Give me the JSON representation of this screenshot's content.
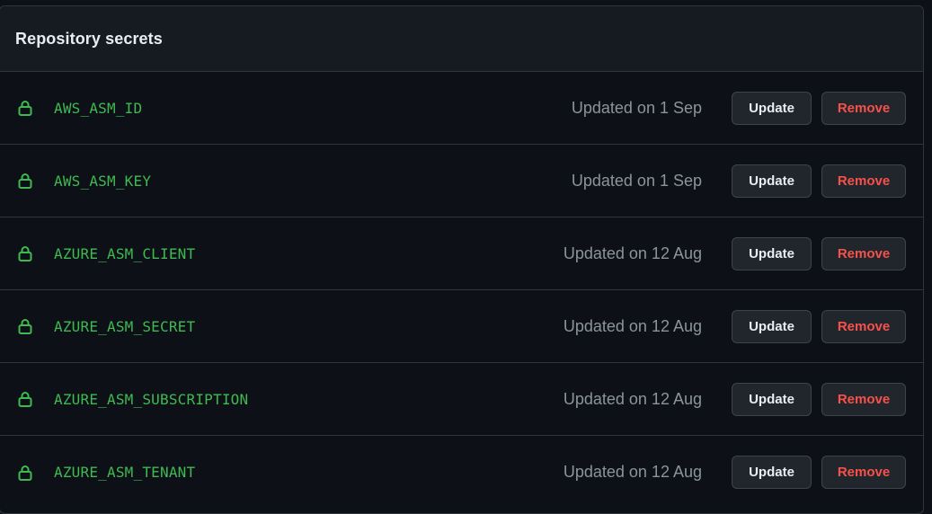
{
  "panel": {
    "title": "Repository secrets"
  },
  "secrets": [
    {
      "name": "AWS_ASM_ID",
      "updated": "Updated on 1 Sep",
      "update_label": "Update",
      "remove_label": "Remove"
    },
    {
      "name": "AWS_ASM_KEY",
      "updated": "Updated on 1 Sep",
      "update_label": "Update",
      "remove_label": "Remove"
    },
    {
      "name": "AZURE_ASM_CLIENT",
      "updated": "Updated on 12 Aug",
      "update_label": "Update",
      "remove_label": "Remove"
    },
    {
      "name": "AZURE_ASM_SECRET",
      "updated": "Updated on 12 Aug",
      "update_label": "Update",
      "remove_label": "Remove"
    },
    {
      "name": "AZURE_ASM_SUBSCRIPTION",
      "updated": "Updated on 12 Aug",
      "update_label": "Update",
      "remove_label": "Remove"
    },
    {
      "name": "AZURE_ASM_TENANT",
      "updated": "Updated on 12 Aug",
      "update_label": "Update",
      "remove_label": "Remove"
    }
  ],
  "icons": {
    "secret_icon": "lock-icon"
  },
  "colors": {
    "background": "#0d1117",
    "header_background": "#161b22",
    "border": "#30363d",
    "secret_name": "#3fb950",
    "muted_text": "#8b949e",
    "danger": "#f85149",
    "button_background": "#21262d"
  }
}
